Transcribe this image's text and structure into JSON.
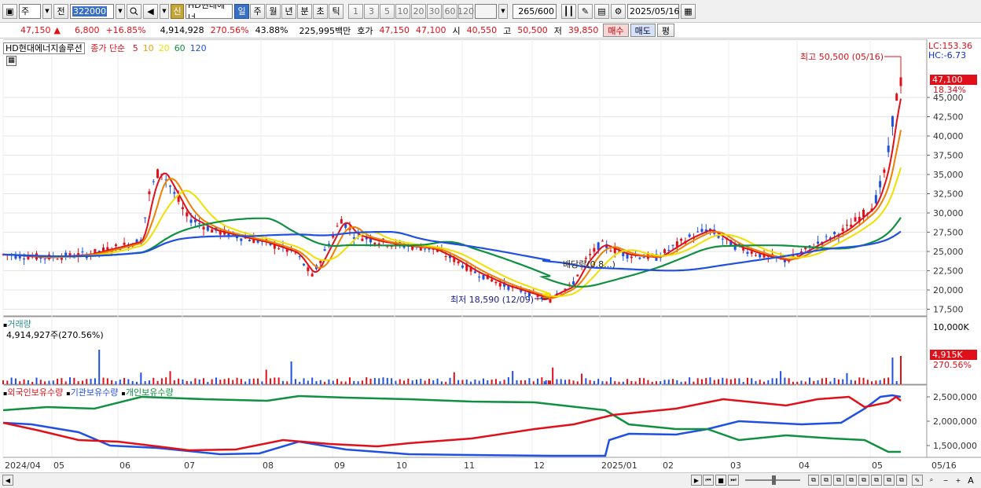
{
  "toolbar": {
    "market": "주",
    "prefix": "전",
    "code": "322000",
    "badge": "신",
    "stock_name": "HD현대에너",
    "periods": [
      "일",
      "주",
      "월",
      "년",
      "분",
      "초",
      "틱"
    ],
    "active_period": "일",
    "intervals": [
      "1",
      "3",
      "5",
      "10",
      "20",
      "30",
      "60",
      "120"
    ],
    "count": "265",
    "count_total": "/600",
    "date": "2025/05/16"
  },
  "quote": {
    "price": "47,150",
    "change_arrow": "▲",
    "change": "6,800",
    "change_pct": "+16.85%",
    "volume": "4,914,928",
    "volume_pct": "270.56%",
    "turnover": "43.88%",
    "amount": "225,995백만",
    "hoga_label": "호가",
    "ask": "47,150",
    "bid": "47,100",
    "open_label": "시",
    "open": "40,550",
    "high_label": "고",
    "high": "50,500",
    "low_label": "저",
    "low": "39,850",
    "buy_label": "매수",
    "sell_label": "매도",
    "avg_label": "평"
  },
  "price_panel": {
    "title": "HD현대에너지솔루션",
    "ma_label": "종가 단순",
    "ma_periods": [
      {
        "label": "5",
        "color": "#e0101a"
      },
      {
        "label": "10",
        "color": "#f0a000"
      },
      {
        "label": "20",
        "color": "#f0e000"
      },
      {
        "label": "60",
        "color": "#109040"
      },
      {
        "label": "120",
        "color": "#2050e0"
      }
    ],
    "lc": "LC:153.36",
    "hc": "HC:-6.73",
    "current_price_tag": "47,100",
    "current_pct_tag": "18.34%",
    "high_annotation": "최고 50,500 (05/16)",
    "low_annotation": "최저 18,590 (12/09)",
    "dividend_annotation": "배당락(0.8...)",
    "y_ticks": [
      "45,000",
      "42,500",
      "40,000",
      "37,500",
      "35,000",
      "32,500",
      "30,000",
      "27,500",
      "25,000",
      "22,500",
      "20,000",
      "17,500"
    ]
  },
  "volume_panel": {
    "title": "거래량",
    "value_label": "4,914,927주(270.56%)",
    "y_tick": "10,000K",
    "current_tag": "4,915K",
    "current_pct": "270.56%"
  },
  "holding_panel": {
    "legend": [
      {
        "label": "외국인보유수량",
        "color": "#e0101a"
      },
      {
        "label": "기관보유수량",
        "color": "#2050e0"
      },
      {
        "label": "개인보유수량",
        "color": "#109040"
      }
    ],
    "y_ticks": [
      "2,500,000",
      "2,000,000",
      "1,500,000"
    ]
  },
  "x_axis": {
    "labels": [
      "2024/04",
      "05",
      "06",
      "07",
      "08",
      "09",
      "10",
      "11",
      "12",
      "2025/01",
      "02",
      "03",
      "04",
      "05"
    ],
    "right_label": "05/16"
  }
}
